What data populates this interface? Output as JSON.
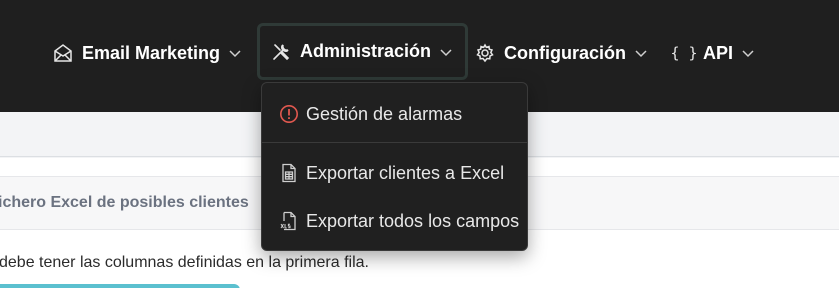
{
  "nav": {
    "email_marketing": {
      "label": "Email Marketing",
      "icon": "envelope-open-icon"
    },
    "administracion": {
      "label": "Administración",
      "icon": "tools-icon"
    },
    "configuracion": {
      "label": "Configuración",
      "icon": "gear-icon"
    },
    "api": {
      "label": "API",
      "icon_text": "{ }"
    }
  },
  "dropdown": {
    "items": [
      {
        "label": "Gestión de alarmas",
        "icon": "alarm-exclamation-icon"
      },
      {
        "label": "Exportar clientes a Excel",
        "icon": "spreadsheet-file-icon"
      },
      {
        "label": "Exportar todos los campos",
        "icon": "xls-file-icon"
      }
    ]
  },
  "card": {
    "header": "ichero Excel de posibles clientes",
    "text": "debe tener las columnas definidas en la primera fila."
  },
  "colors": {
    "topbar": "#1f1f1f",
    "alarm_icon": "#e0584f",
    "accent_bar": "#5bc0cf"
  }
}
